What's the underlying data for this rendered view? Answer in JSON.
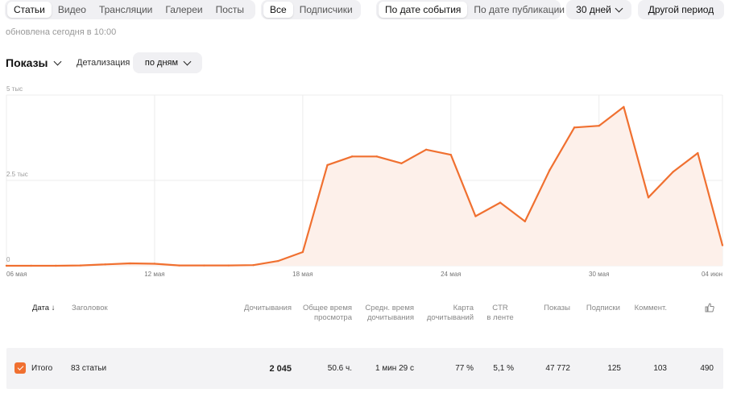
{
  "content_tabs": [
    "Статьи",
    "Видео",
    "Трансляции",
    "Галереи",
    "Посты"
  ],
  "audience_tabs": [
    "Все",
    "Подписчики"
  ],
  "date_mode_tabs": [
    "По дате события",
    "По дате публикации"
  ],
  "period_select": "30 дней",
  "other_period_button": "Другой период",
  "updated_text": "обновлена сегодня в 10:00",
  "metric_select": "Показы",
  "detail_label": "Детализация",
  "detail_select": "по дням",
  "colors": {
    "line": "#f07030",
    "area": "#fdf0ea",
    "accent": "#f07030"
  },
  "chart_data": {
    "type": "area",
    "title": "",
    "xlabel": "",
    "ylabel": "",
    "ylim": [
      0,
      5000
    ],
    "yticks": [
      {
        "value": 5000,
        "label": "5 тыс"
      },
      {
        "value": 2500,
        "label": "2.5 тыс"
      },
      {
        "value": 0,
        "label": "0"
      }
    ],
    "xticks": [
      "06 мая",
      "12 мая",
      "18 мая",
      "24 мая",
      "30 мая",
      "04 июн"
    ],
    "grid": true,
    "x": [
      "06 мая",
      "07 мая",
      "08 мая",
      "09 мая",
      "10 мая",
      "11 мая",
      "12 мая",
      "13 мая",
      "14 мая",
      "15 мая",
      "16 мая",
      "17 мая",
      "18 мая",
      "19 мая",
      "20 мая",
      "21 мая",
      "22 мая",
      "23 мая",
      "24 мая",
      "25 мая",
      "26 мая",
      "27 мая",
      "28 мая",
      "29 мая",
      "30 мая",
      "31 мая",
      "01 июн",
      "02 июн",
      "03 июн",
      "04 июн"
    ],
    "values": [
      0,
      0,
      0,
      10,
      40,
      70,
      60,
      10,
      10,
      10,
      20,
      140,
      400,
      2950,
      3200,
      3200,
      3000,
      3400,
      3250,
      1450,
      1850,
      1300,
      2800,
      4050,
      4100,
      4650,
      2000,
      2750,
      3300,
      600
    ]
  },
  "table": {
    "headers": {
      "date": "Дата",
      "title": "Заголовок",
      "views": "Дочитывания",
      "total_time": [
        "Общее время",
        "просмотра"
      ],
      "avg_time": [
        "Средн. время",
        "дочитывания"
      ],
      "card": [
        "Карта",
        "дочитываний"
      ],
      "ctr": [
        "CTR",
        "в ленте"
      ],
      "impressions": "Показы",
      "subs": "Подписки",
      "comments": "Коммент."
    },
    "total_row": {
      "label": "Итого",
      "title": "83 статьи",
      "views": "2 045",
      "total_time": "50.6 ч.",
      "avg_time": "1 мин 29 с",
      "card": "77 %",
      "ctr": "5,1 %",
      "impressions": "47 772",
      "subs": "125",
      "comments": "103",
      "likes": "490"
    }
  }
}
